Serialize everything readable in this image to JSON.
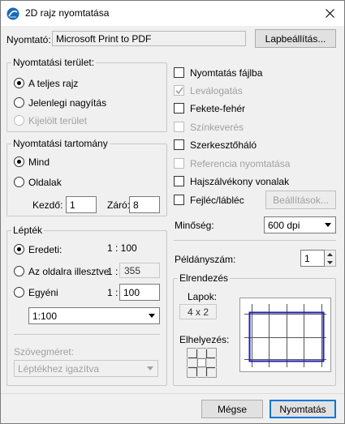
{
  "window": {
    "title": "2D rajz nyomtatása"
  },
  "printer": {
    "label": "Nyomtató:",
    "name": "Microsoft Print to PDF",
    "setup_button": "Lapbeállítás..."
  },
  "print_area": {
    "title": "Nyomtatási terület:",
    "options": [
      {
        "label": "A teljes rajz",
        "checked": true,
        "disabled": false
      },
      {
        "label": "Jelenlegi nagyítás",
        "checked": false,
        "disabled": false
      },
      {
        "label": "Kijelölt terület",
        "checked": false,
        "disabled": true
      }
    ]
  },
  "print_range": {
    "title": "Nyomtatási tartomány",
    "all_label": "Mind",
    "pages_label": "Oldalak",
    "from_label": "Kezdő:",
    "from_value": "1",
    "to_label": "Záró:",
    "to_value": "8"
  },
  "scale": {
    "title": "Lépték",
    "original_label": "Eredeti:",
    "original_value": "1 : 100",
    "fit_label": "Az oldalra illesztve",
    "fit_prefix": "1 :",
    "fit_value": "355",
    "custom_label": "Egyéni",
    "custom_prefix": "1 :",
    "custom_value": "100",
    "dropdown_value": "1:100"
  },
  "text_size": {
    "label": "Szövegméret:",
    "value": "Léptékhez igazítva"
  },
  "options": {
    "print_to_file": "Nyomtatás fájlba",
    "collate": "Leválogatás",
    "black_white": "Fekete-fehér",
    "color_mix": "Színkeverés",
    "grid": "Szerkesztőháló",
    "reference": "Referencia nyomtatása",
    "hairline": "Hajszálvékony vonalak",
    "header_footer": "Fejléc/lábléc",
    "settings_button": "Beállítások..."
  },
  "quality": {
    "label": "Minőség:",
    "value": "600 dpi"
  },
  "copies": {
    "label": "Példányszám:",
    "value": "1"
  },
  "layout": {
    "title": "Elrendezés",
    "pages_label": "Lapok:",
    "pages_value": "4 x 2",
    "placement_label": "Elhelyezés:"
  },
  "footer": {
    "cancel": "Mégse",
    "print": "Nyomtatás"
  },
  "colors": {
    "accent": "#0078d7",
    "layout_grid": "#1f1fb0"
  }
}
